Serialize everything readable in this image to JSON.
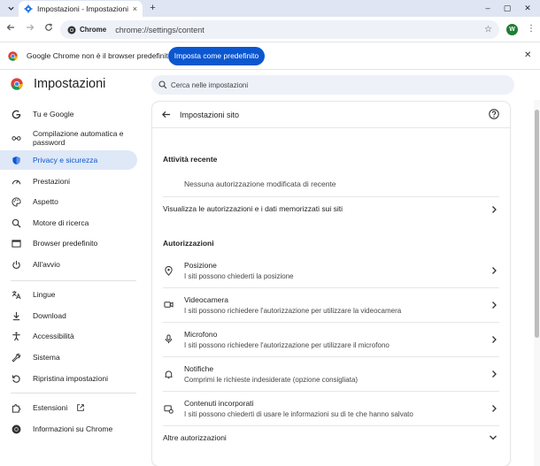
{
  "browser": {
    "tab_title": "Impostazioni - Impostazioni sito",
    "tab_close": "×",
    "new_tab": "+",
    "address_chip": "Chrome",
    "url": "chrome://settings/content",
    "avatar_letter": "W",
    "minimize": "–",
    "maximize": "▢",
    "close": "✕"
  },
  "infobar": {
    "message": "Google Chrome non è il browser predefinito",
    "button_label": "Imposta come predefinito",
    "close": "✕"
  },
  "settings_header": {
    "title": "Impostazioni",
    "search_placeholder": "Cerca nelle impostazioni"
  },
  "sidebar": {
    "items": [
      {
        "label": "Tu e Google",
        "icon": "google-g-icon"
      },
      {
        "label": "Compilazione automatica e password",
        "icon": "key-icon"
      },
      {
        "label": "Privacy e sicurezza",
        "icon": "shield-icon",
        "active": true
      },
      {
        "label": "Prestazioni",
        "icon": "speedometer-icon"
      },
      {
        "label": "Aspetto",
        "icon": "palette-icon"
      },
      {
        "label": "Motore di ricerca",
        "icon": "search-icon"
      },
      {
        "label": "Browser predefinito",
        "icon": "browser-window-icon"
      },
      {
        "label": "All'avvio",
        "icon": "power-icon"
      },
      {
        "label": "Lingue",
        "icon": "translate-icon"
      },
      {
        "label": "Download",
        "icon": "download-icon"
      },
      {
        "label": "Accessibilità",
        "icon": "accessibility-icon"
      },
      {
        "label": "Sistema",
        "icon": "wrench-icon"
      },
      {
        "label": "Ripristina impostazioni",
        "icon": "reset-icon"
      },
      {
        "label": "Estensioni",
        "icon": "puzzle-icon"
      },
      {
        "label": "Informazioni su Chrome",
        "icon": "chrome-icon"
      }
    ]
  },
  "main": {
    "title": "Impostazioni sito",
    "recent_activity": {
      "heading": "Attività recente",
      "empty_text": "Nessuna autorizzazione modificata di recente"
    },
    "view_permissions_label": "Visualizza le autorizzazioni e i dati memorizzati sui siti",
    "permissions": {
      "heading": "Autorizzazioni",
      "items": [
        {
          "title": "Posizione",
          "subtitle": "I siti possono chiederti la posizione",
          "icon": "location-pin-icon"
        },
        {
          "title": "Videocamera",
          "subtitle": "I siti possono richiedere l'autorizzazione per utilizzare la videocamera",
          "icon": "camera-icon"
        },
        {
          "title": "Microfono",
          "subtitle": "I siti possono richiedere l'autorizzazione per utilizzare il microfono",
          "icon": "microphone-icon"
        },
        {
          "title": "Notifiche",
          "subtitle": "Comprimi le richieste indesiderate (opzione consigliata)",
          "icon": "bell-icon"
        },
        {
          "title": "Contenuti incorporati",
          "subtitle": "I siti possono chiederti di usare le informazioni su di te che hanno salvato",
          "icon": "embedded-content-icon"
        }
      ]
    },
    "more_permissions_label": "Altre autorizzazioni"
  },
  "colors": {
    "accent": "#0b57d0",
    "active_nav_bg": "#dfe8f7",
    "tabstrip_bg": "#dfe5f2",
    "omnibox_bg": "#eef1f8"
  }
}
